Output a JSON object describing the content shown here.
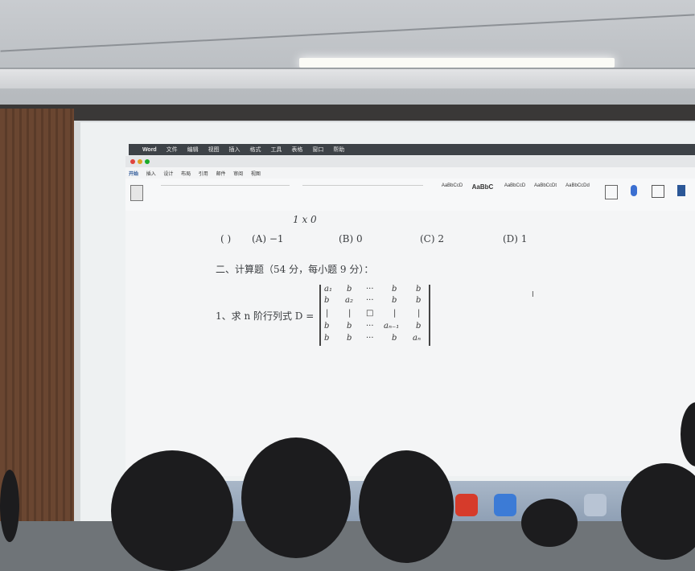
{
  "menubar": {
    "app": "Word",
    "items": [
      "文件",
      "编辑",
      "视图",
      "插入",
      "格式",
      "工具",
      "表格",
      "窗口",
      "帮助"
    ]
  },
  "ribbon": {
    "tabs": [
      "开始",
      "插入",
      "设计",
      "布局",
      "引用",
      "邮件",
      "审阅",
      "视图"
    ],
    "styles": [
      "AaBbCcD",
      "AaBbC",
      "AaBbCcD",
      "AaBbCcDt",
      "AaBbCcDd"
    ]
  },
  "document": {
    "options_line": {
      "blank": "(    )",
      "a": "(A)  −1",
      "b": "(B)  0",
      "c": "(C)  2",
      "d": "(D)  1"
    },
    "section_heading": "二、计算题（54 分，每小题 9 分）：",
    "question": "1、求 n 阶行列式 D =",
    "partial_row": "1   x   0",
    "matrix": {
      "rows": [
        [
          "a₁",
          "b",
          "···",
          "b",
          "b"
        ],
        [
          "b",
          "a₂",
          "···",
          "b",
          "b"
        ],
        [
          "|",
          "|",
          "□",
          "|",
          "|"
        ],
        [
          "b",
          "b",
          "···",
          "aₙ₋₁",
          "b"
        ],
        [
          "b",
          "b",
          "···",
          "b",
          "aₙ"
        ]
      ]
    }
  }
}
